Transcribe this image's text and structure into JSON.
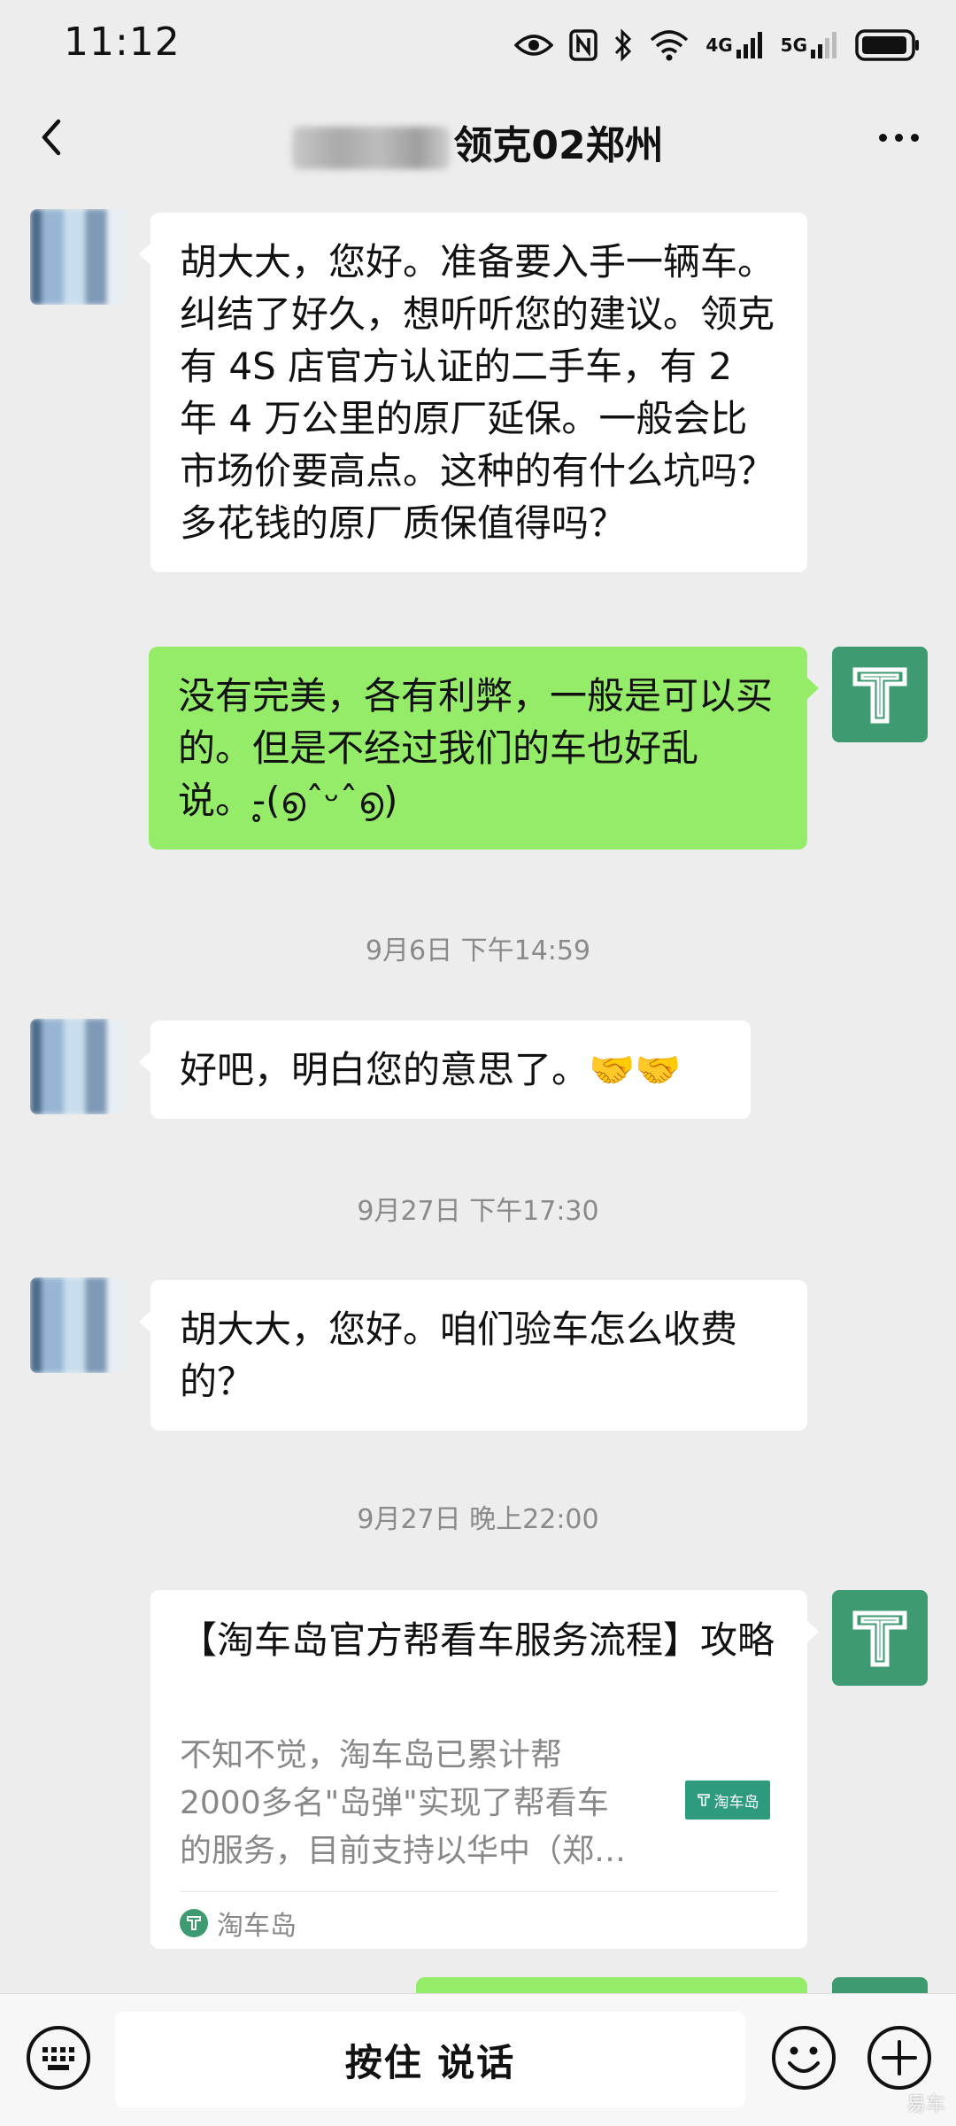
{
  "status_bar": {
    "time": "11:12",
    "net1": "4G",
    "net2": "5G"
  },
  "nav": {
    "title": "领克02郑州"
  },
  "messages": [
    {
      "side": "left",
      "text": "胡大大，您好。准备要入手一辆车。纠结了好久，想听听您的建议。领克有 4S 店官方认证的二手车，有 2 年 4 万公里的原厂延保。一般会比市场价要高点。这种的有什么坑吗？多花钱的原厂质保值得吗？"
    },
    {
      "side": "right",
      "text": "没有完美，各有利弊，一般是可以买的。但是不经过我们的车也好乱说。-̥(൭ˆᵕˆ൭)"
    },
    {
      "side": "left",
      "text": "好吧，明白您的意思了。🤝🤝"
    },
    {
      "side": "left",
      "text": "胡大大，您好。咱们验车怎么收费的？"
    }
  ],
  "timestamps": [
    "9月6日 下午14:59",
    "9月27日 下午17:30",
    "9月27日 晚上22:00"
  ],
  "card": {
    "title": "【淘车岛官方帮看车服务流程】攻略",
    "desc": "不知不觉，淘车岛已累计帮2000多名\"岛弹\"实现了帮看车的服务，目前支持以华中（郑…",
    "thumb_text": "淘车岛",
    "source": "淘车岛"
  },
  "input_bar": {
    "voice_label": "按住 说话"
  },
  "watermark": "易车",
  "colors": {
    "background": "#ededed",
    "bubble_self": "#95ec69",
    "bubble_other": "#ffffff",
    "avatar_brand": "#3e9a70"
  }
}
